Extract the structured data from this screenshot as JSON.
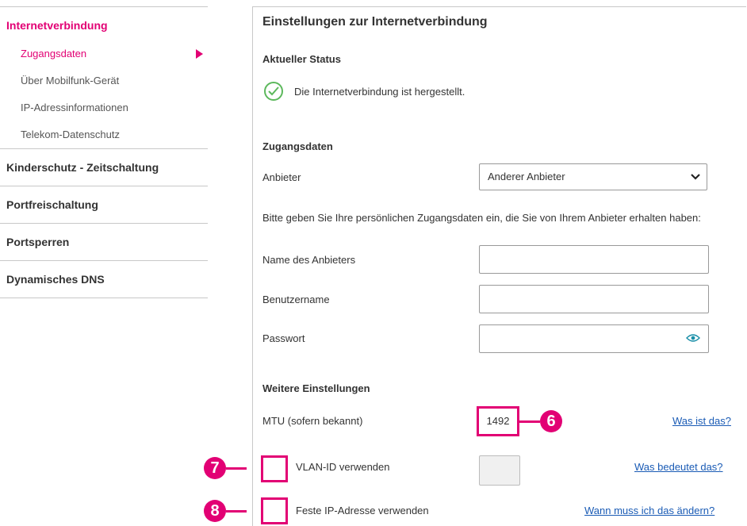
{
  "sidebar": {
    "items": [
      {
        "label": "Internetverbindung",
        "active": true,
        "subitems": [
          {
            "label": "Zugangsdaten",
            "active": true
          },
          {
            "label": "Über Mobilfunk-Gerät",
            "active": false
          },
          {
            "label": "IP-Adressinformationen",
            "active": false
          },
          {
            "label": "Telekom-Datenschutz",
            "active": false
          }
        ]
      },
      {
        "label": "Kinderschutz - Zeitschaltung"
      },
      {
        "label": "Portfreischaltung"
      },
      {
        "label": "Portsperren"
      },
      {
        "label": "Dynamisches DNS"
      }
    ]
  },
  "main": {
    "title": "Einstellungen zur Internetverbindung",
    "status": {
      "heading": "Aktueller Status",
      "text": "Die Internetverbindung ist hergestellt."
    },
    "access": {
      "heading": "Zugangsdaten",
      "provider_label": "Anbieter",
      "provider_value": "Anderer Anbieter",
      "description": "Bitte geben Sie Ihre persönlichen Zugangsdaten ein, die Sie von Ihrem Anbieter erhalten haben:",
      "provider_name_label": "Name des Anbieters",
      "username_label": "Benutzername",
      "password_label": "Passwort"
    },
    "more": {
      "heading": "Weitere Einstellungen",
      "mtu_label": "MTU (sofern bekannt)",
      "mtu_value": "1492",
      "mtu_link": "Was ist das?",
      "vlan_label": "VLAN-ID verwenden",
      "vlan_link": "Was bedeutet das?",
      "ip_label": "Feste IP-Adresse verwenden",
      "ip_link": "Wann muss ich das ändern?"
    },
    "callouts": {
      "mtu": "6",
      "vlan": "7",
      "ip": "8"
    }
  },
  "colors": {
    "accent": "#e20074",
    "success": "#5cb85c",
    "link": "#1a5bb5"
  }
}
